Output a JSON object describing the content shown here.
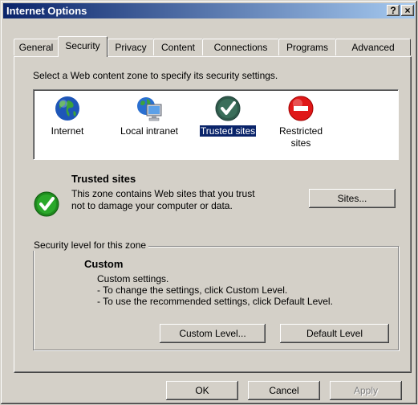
{
  "window": {
    "title": "Internet Options",
    "help_button": "?",
    "close_button": "×"
  },
  "tabs": [
    {
      "label": "General"
    },
    {
      "label": "Security"
    },
    {
      "label": "Privacy"
    },
    {
      "label": "Content"
    },
    {
      "label": "Connections"
    },
    {
      "label": "Programs"
    },
    {
      "label": "Advanced"
    }
  ],
  "instruction": "Select a Web content zone to specify its security settings.",
  "zones": [
    {
      "label": "Internet",
      "icon": "globe-icon"
    },
    {
      "label": "Local intranet",
      "icon": "local-intranet-icon"
    },
    {
      "label": "Trusted sites",
      "icon": "trusted-sites-icon",
      "selected": true
    },
    {
      "label": "Restricted sites",
      "icon": "restricted-sites-icon"
    }
  ],
  "zone_info": {
    "title": "Trusted sites",
    "description": "This zone contains Web sites that you trust not to damage your computer or data.",
    "sites_button": "Sites..."
  },
  "security": {
    "group_label": "Security level for this zone",
    "level": "Custom",
    "lines": [
      "Custom settings.",
      "- To change the settings, click Custom Level.",
      "- To use the recommended settings, click Default Level."
    ],
    "custom_button": "Custom Level...",
    "default_button": "Default Level"
  },
  "footer": {
    "ok": "OK",
    "cancel": "Cancel",
    "apply": "Apply"
  }
}
